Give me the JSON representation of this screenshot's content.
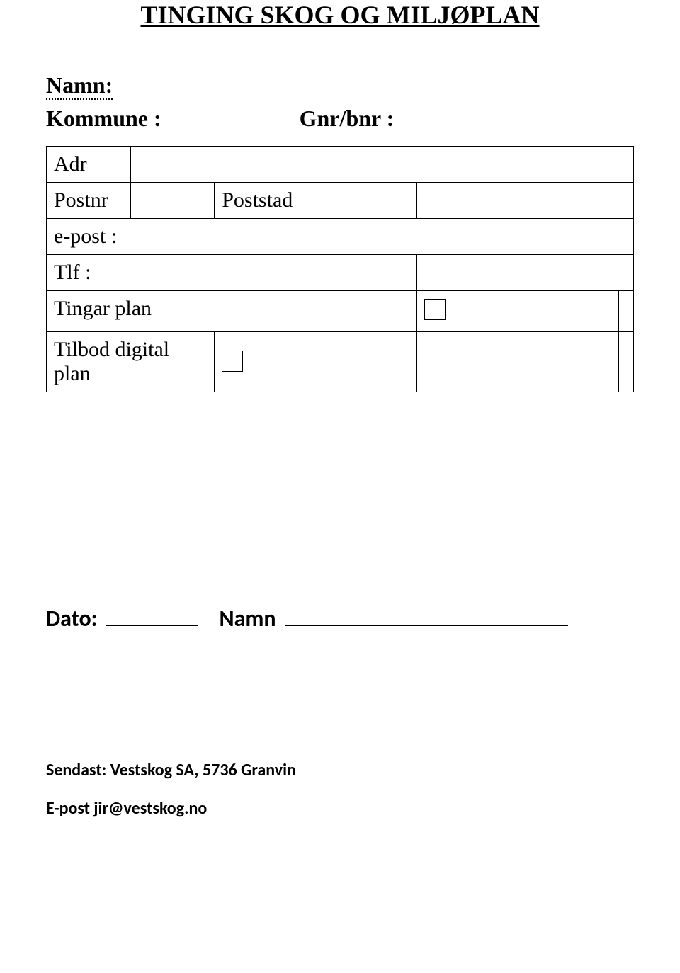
{
  "title": "TINGING SKOG OG MILJØPLAN",
  "labels": {
    "namn": "Namn:",
    "kommune": "Kommune :",
    "gnrbnr": "Gnr/bnr :",
    "adr": "Adr",
    "postnr": "Postnr",
    "poststad": "Poststad",
    "epost": "e-post :",
    "tlf": "Tlf :",
    "tingar_plan": "Tingar plan",
    "tilbod_digital": "Tilbod digital plan"
  },
  "signature": {
    "dato": "Dato:",
    "namn": "Namn"
  },
  "footer": {
    "sendast": "Sendast: Vestskog SA, 5736 Granvin",
    "epost": "E-post jir@vestskog.no"
  }
}
